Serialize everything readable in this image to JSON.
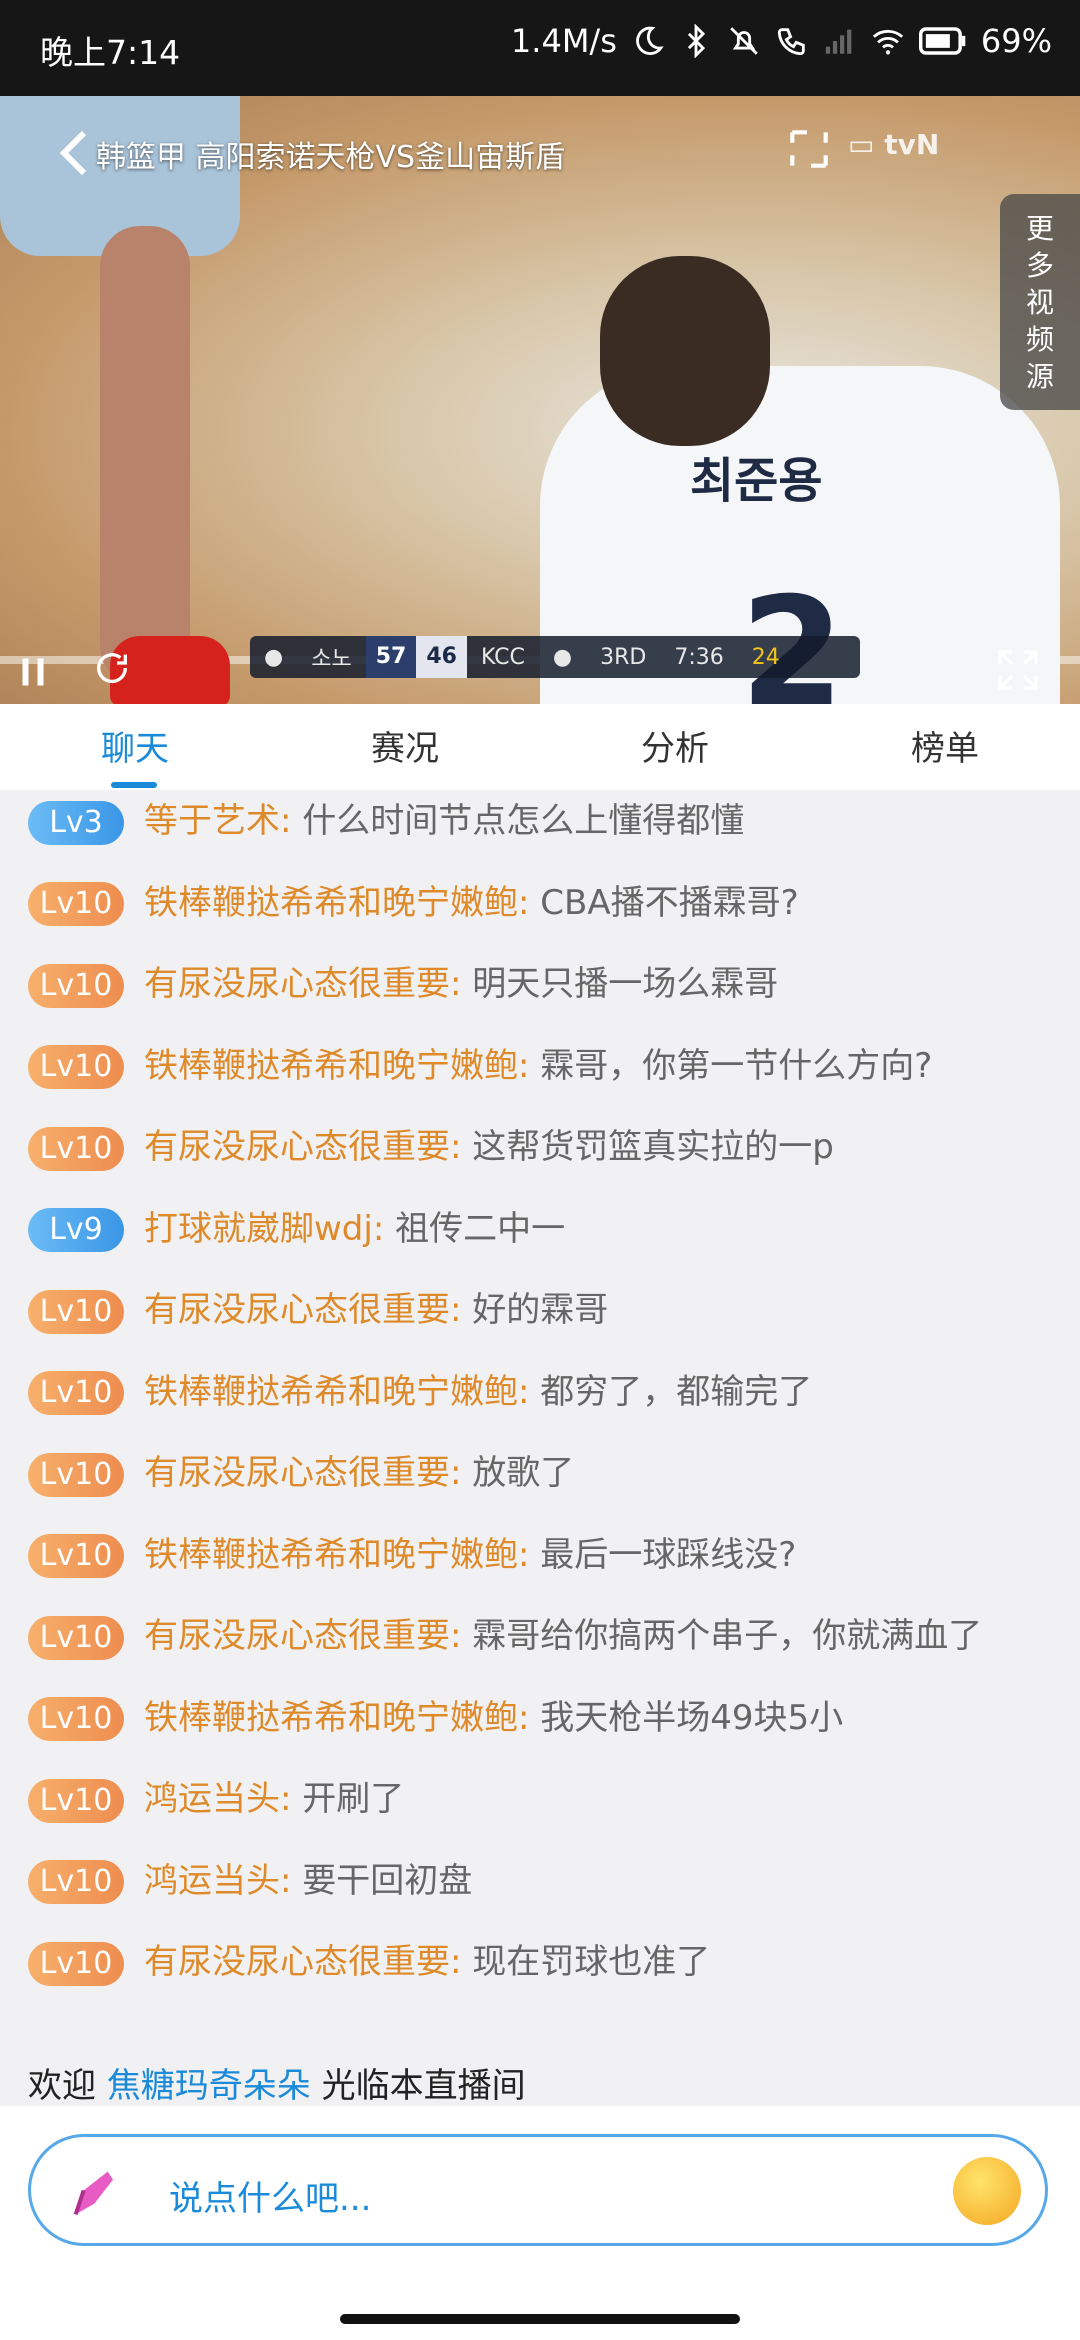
{
  "status_bar": {
    "time": "晚上7:14",
    "speed": "1.4M/s",
    "battery": "69%"
  },
  "video": {
    "title": "韩篮甲 高阳索诺天枪VS釜山宙斯盾",
    "more_sources": [
      "更",
      "多",
      "视",
      "频",
      "源"
    ],
    "scoreboard": {
      "team_a": "소노",
      "score_a": "57",
      "score_b": "46",
      "team_b": "KCC",
      "quarter": "3RD",
      "clock": "7:36",
      "shot_clock": "24"
    }
  },
  "tabs": [
    "聊天",
    "赛况",
    "分析",
    "榜单"
  ],
  "chat": [
    {
      "level": "Lv3",
      "color": "blue",
      "user": "等于艺术",
      "text": "什么时间节点怎么上懂得都懂"
    },
    {
      "level": "Lv10",
      "color": "orange",
      "user": "铁棒鞭挞希希和晚宁嫩鲍",
      "text": "CBA播不播霖哥?"
    },
    {
      "level": "Lv10",
      "color": "orange",
      "user": "有尿没尿心态很重要",
      "text": "明天只播一场么霖哥"
    },
    {
      "level": "Lv10",
      "color": "orange",
      "user": "铁棒鞭挞希希和晚宁嫩鲍",
      "text": "霖哥，你第一节什么方向?"
    },
    {
      "level": "Lv10",
      "color": "orange",
      "user": "有尿没尿心态很重要",
      "text": "这帮货罚篮真实拉的一p"
    },
    {
      "level": "Lv9",
      "color": "blue",
      "user": "打球就崴脚wdj",
      "text": "祖传二中一"
    },
    {
      "level": "Lv10",
      "color": "orange",
      "user": "有尿没尿心态很重要",
      "text": "好的霖哥"
    },
    {
      "level": "Lv10",
      "color": "orange",
      "user": "铁棒鞭挞希希和晚宁嫩鲍",
      "text": "都穷了，都输完了"
    },
    {
      "level": "Lv10",
      "color": "orange",
      "user": "有尿没尿心态很重要",
      "text": "放歌了"
    },
    {
      "level": "Lv10",
      "color": "orange",
      "user": "铁棒鞭挞希希和晚宁嫩鲍",
      "text": "最后一球踩线没?"
    },
    {
      "level": "Lv10",
      "color": "orange",
      "user": "有尿没尿心态很重要",
      "text": "霖哥给你搞两个串子，你就满血了"
    },
    {
      "level": "Lv10",
      "color": "orange",
      "user": "铁棒鞭挞希希和晚宁嫩鲍",
      "text": "我天枪半场49块5小"
    },
    {
      "level": "Lv10",
      "color": "orange",
      "user": "鸿运当头",
      "text": "开刷了"
    },
    {
      "level": "Lv10",
      "color": "orange",
      "user": "鸿运当头",
      "text": "要干回初盘"
    },
    {
      "level": "Lv10",
      "color": "orange",
      "user": "有尿没尿心态很重要",
      "text": "现在罚球也准了"
    }
  ],
  "welcome": {
    "prefix": "欢迎",
    "user": "焦糖玛奇朵朵",
    "suffix": "光临本直播间"
  },
  "input": {
    "placeholder": "说点什么吧..."
  }
}
